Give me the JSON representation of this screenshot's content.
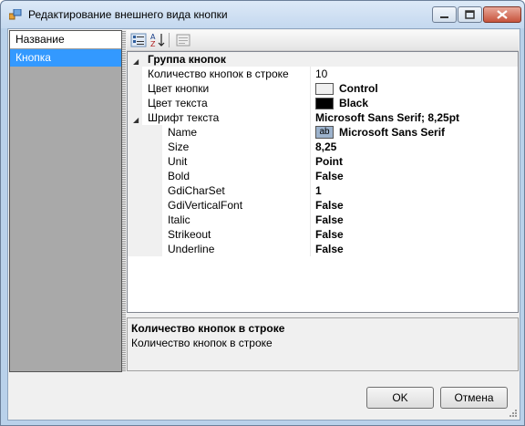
{
  "window": {
    "title": "Редактирование внешнего вида кнопки"
  },
  "list": {
    "header": "Название",
    "items": [
      "Кнопка"
    ]
  },
  "grid": {
    "category": "Группа кнопок",
    "props": {
      "button_count": {
        "name": "Количество кнопок в строке",
        "value": "10"
      },
      "button_color": {
        "name": "Цвет кнопки",
        "value": "Control",
        "color": "#f0f0f0"
      },
      "text_color": {
        "name": "Цвет текста",
        "value": "Black",
        "color": "#000000"
      },
      "font": {
        "name": "Шрифт текста",
        "value": "Microsoft Sans Serif; 8,25pt"
      }
    },
    "font_sub": {
      "name": {
        "name": "Name",
        "value": "Microsoft Sans Serif",
        "preview": "ab"
      },
      "size": {
        "name": "Size",
        "value": "8,25"
      },
      "unit": {
        "name": "Unit",
        "value": "Point"
      },
      "bold": {
        "name": "Bold",
        "value": "False"
      },
      "charset": {
        "name": "GdiCharSet",
        "value": "1"
      },
      "vertical": {
        "name": "GdiVerticalFont",
        "value": "False"
      },
      "italic": {
        "name": "Italic",
        "value": "False"
      },
      "strikeout": {
        "name": "Strikeout",
        "value": "False"
      },
      "underline": {
        "name": "Underline",
        "value": "False"
      }
    }
  },
  "description": {
    "title": "Количество кнопок в строке",
    "text": "Количество кнопок в строке"
  },
  "buttons": {
    "ok": "OK",
    "cancel": "Отмена"
  }
}
